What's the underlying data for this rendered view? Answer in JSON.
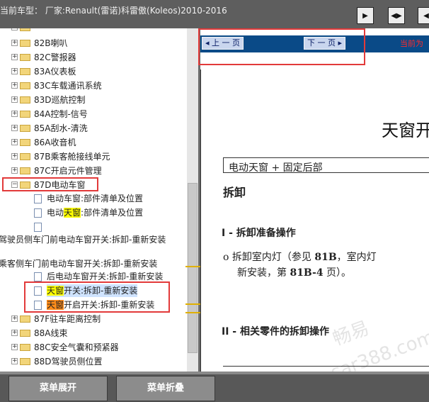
{
  "header": {
    "car_title": "当前车型：  厂家:Renault(雷诺)科雷傲(Koleos)2010-2016",
    "buttons": [
      {
        "name": "expand-right-button",
        "icon": "▶"
      },
      {
        "name": "split-view-button",
        "icon": "◀▶"
      },
      {
        "name": "expand-left-button",
        "icon": "◀"
      }
    ]
  },
  "tree": {
    "folders": [
      {
        "label": "82B喇叭"
      },
      {
        "label": "82C警报器"
      },
      {
        "label": "83A仪表板"
      },
      {
        "label": "83C车载通讯系统"
      },
      {
        "label": "83D巡航控制"
      },
      {
        "label": "84A控制-信号"
      },
      {
        "label": "85A刮水-清洗"
      },
      {
        "label": "86A收音机"
      },
      {
        "label": "87B乘客舱接线单元"
      },
      {
        "label": "87C开启元件管理"
      },
      {
        "label": "87D电动车窗"
      }
    ],
    "open_folder": {
      "label": "87D电动车窗"
    },
    "leaves": [
      {
        "pre": "电动车窗:部件清单及位置",
        "hl": "",
        "post": ""
      },
      {
        "pre": "电动",
        "hl": "天窗",
        "post": ":部件清单及位置"
      },
      {
        "pre": "",
        "hl": "",
        "post": ""
      }
    ],
    "long_items": [
      "驾驶员侧车门前电动车窗开关:拆卸-重新安装",
      "乘客侧车门前电动车窗开关:拆卸-重新安装"
    ],
    "leaves2": [
      {
        "pre": "后电动车窗开关:拆卸-重新安装",
        "hl": "",
        "post": ""
      },
      {
        "pre": "",
        "hl": "天窗",
        "post": "开关:拆卸-重新安装"
      },
      {
        "pre": "",
        "hl": "天窗",
        "post": "开启开关:拆卸-重新安装"
      }
    ],
    "folders2": [
      {
        "label": "87F驻车距离控制"
      },
      {
        "label": "88A线束"
      },
      {
        "label": "88C安全气囊和预紧器"
      },
      {
        "label": "88D驾驶员侧位置"
      }
    ]
  },
  "content": {
    "prev_label": "上 一 页",
    "next_label": "下 一 页",
    "current_page": "当前为",
    "title": "天窗开",
    "section": "电动天窗 + 固定后部",
    "h1": "拆卸",
    "h2a": "I - 拆卸准备操作",
    "bullet_line1_pre": "o  拆卸室内灯（参见 ",
    "bullet_ref": "81B",
    "bullet_line1_post": "，室内灯",
    "bullet_line2_pre": "新安装，第 ",
    "bullet_ref2": "81B-4",
    "bullet_line2_post": " 页）。",
    "h2b": "II - 相关零件的拆卸操作",
    "watermark1": "畅易",
    "watermark2": "car388.com"
  },
  "footer": {
    "expand_label": "菜单展开",
    "collapse_label": "菜单折叠"
  },
  "colors": {
    "highlight_yellow": "#ffff00",
    "highlight_orange": "#ff8c1a",
    "annotation_red": "#e23a3a",
    "nav_blue": "#0a4a87"
  }
}
